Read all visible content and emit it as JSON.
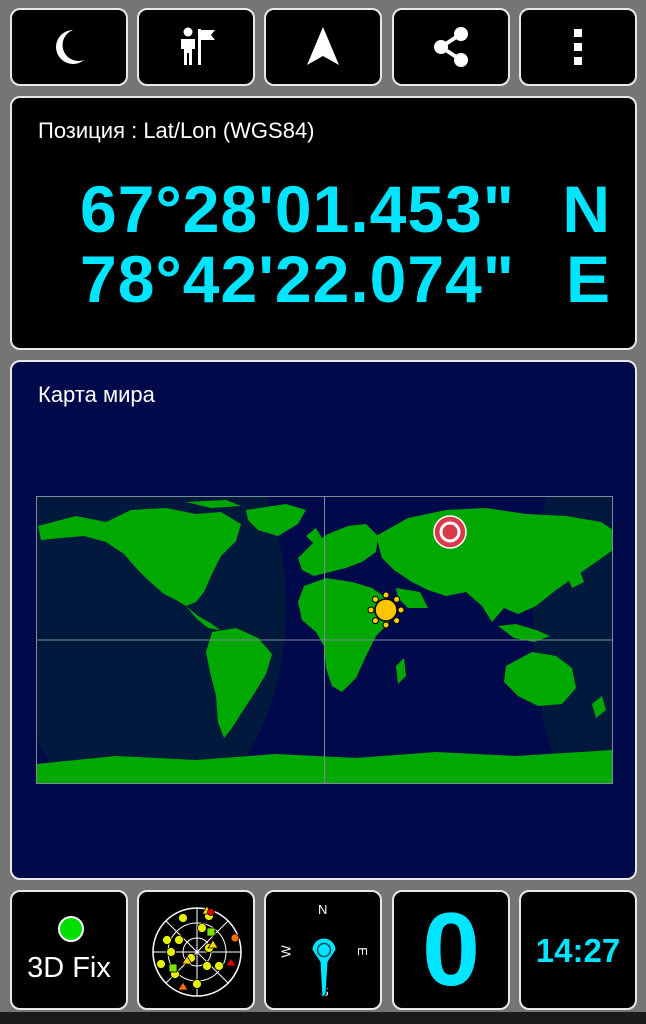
{
  "toolbar": {
    "buttons": [
      {
        "name": "night-mode-button",
        "icon": "moon-icon"
      },
      {
        "name": "waypoint-button",
        "icon": "person-flag-icon"
      },
      {
        "name": "navigation-button",
        "icon": "navigation-arrow-icon"
      },
      {
        "name": "share-button",
        "icon": "share-icon"
      },
      {
        "name": "menu-button",
        "icon": "more-vertical-icon"
      }
    ]
  },
  "position": {
    "label": "Позиция : Lat/Lon (WGS84)",
    "lat_value": "67°28'01.453\"",
    "lat_hemi": "N",
    "lon_value": "78°42'22.074\"",
    "lon_hemi": "E"
  },
  "map": {
    "label": "Карта мира",
    "colors": {
      "background": "#000a4a",
      "land": "#00a800",
      "night": "#001c3a",
      "grid": "#7f8a99"
    },
    "marker_icon": "location-marker-icon",
    "sun_icon": "sun-icon"
  },
  "status": {
    "fix_label": "3D Fix",
    "fix_color": "#00e000",
    "sky_icon": "satellite-sky-plot-icon",
    "compass": {
      "n": "N",
      "e": "E",
      "s": "S",
      "w": "W"
    },
    "speed": "0",
    "time": "14:27",
    "accent": "#00e5ff"
  }
}
